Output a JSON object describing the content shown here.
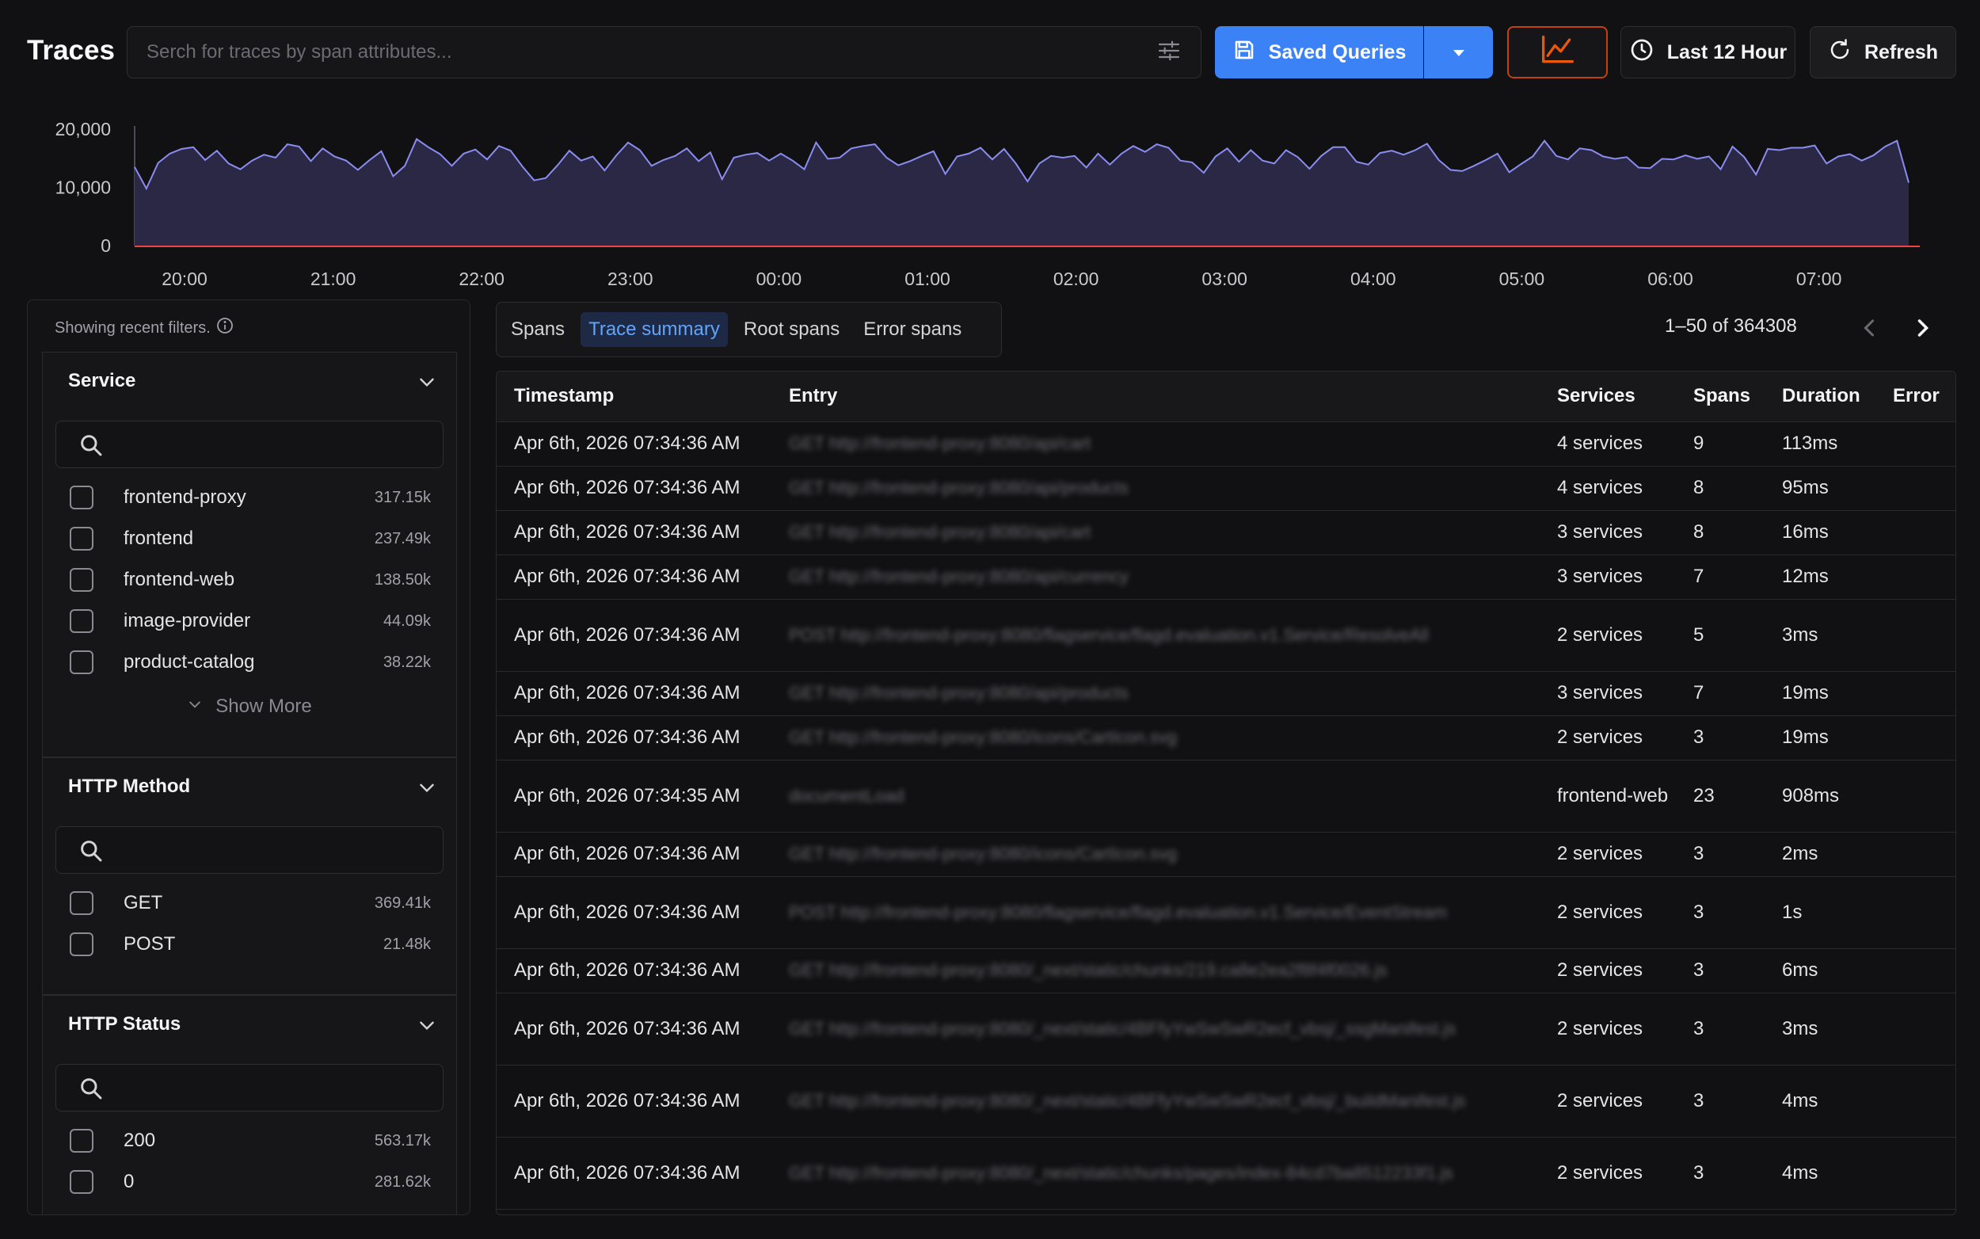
{
  "header": {
    "title": "Traces",
    "search_placeholder": "Serch for traces by span attributes...",
    "saved_queries_label": "Saved Queries",
    "time_range_label": "Last 12 Hour",
    "refresh_label": "Refresh"
  },
  "histogram": {
    "y_ticks": [
      "20,000",
      "10,000",
      "0"
    ],
    "x_ticks": [
      "20:00",
      "21:00",
      "22:00",
      "23:00",
      "00:00",
      "01:00",
      "02:00",
      "03:00",
      "04:00",
      "05:00",
      "06:00",
      "07:00"
    ],
    "ylim": [
      0,
      20000
    ],
    "series_color": "#8b8cf0",
    "error_color": "#ef4444",
    "values": [
      13500,
      9800,
      14200,
      15800,
      16600,
      16900,
      14700,
      16300,
      14100,
      13100,
      14600,
      15600,
      15100,
      17400,
      17000,
      14500,
      16700,
      15300,
      14600,
      13000,
      14700,
      16200,
      11900,
      13700,
      18300,
      16900,
      15700,
      13700,
      15800,
      16500,
      14800,
      17100,
      16300,
      13600,
      11200,
      11600,
      13800,
      16300,
      14600,
      15300,
      12900,
      15500,
      17700,
      16400,
      13700,
      14700,
      15400,
      16700,
      14500,
      16000,
      11400,
      15100,
      15600,
      15900,
      14600,
      15800,
      14600,
      13100,
      17700,
      14900,
      15100,
      16700,
      17100,
      17400,
      15100,
      13800,
      14500,
      15400,
      16200,
      12300,
      15300,
      15800,
      16800,
      14800,
      16600,
      14100,
      11000,
      14100,
      15400,
      15100,
      15400,
      13400,
      15800,
      13900,
      15800,
      17100,
      16100,
      17400,
      16800,
      14600,
      14300,
      12500,
      15300,
      16700,
      14400,
      16400,
      14600,
      14100,
      16400,
      15200,
      13200,
      15400,
      16900,
      16900,
      14400,
      13900,
      15900,
      16300,
      15600,
      16400,
      17500,
      14700,
      13000,
      12800,
      13700,
      14700,
      15800,
      12600,
      14000,
      15300,
      18000,
      15400,
      14800,
      16700,
      16400,
      15300,
      14900,
      15200,
      13400,
      13300,
      14900,
      14800,
      15500,
      14900,
      15300,
      13100,
      17000,
      15200,
      12200,
      16600,
      16400,
      16800,
      16800,
      17200,
      14100,
      15300,
      15700,
      14600,
      15500,
      17000,
      18000,
      10800
    ]
  },
  "filters": {
    "recent_note": "Showing recent filters.",
    "service": {
      "title": "Service",
      "options": [
        {
          "label": "frontend-proxy",
          "count": "317.15k"
        },
        {
          "label": "frontend",
          "count": "237.49k"
        },
        {
          "label": "frontend-web",
          "count": "138.50k"
        },
        {
          "label": "image-provider",
          "count": "44.09k"
        },
        {
          "label": "product-catalog",
          "count": "38.22k"
        }
      ],
      "show_more": "Show More"
    },
    "http_method": {
      "title": "HTTP Method",
      "options": [
        {
          "label": "GET",
          "count": "369.41k"
        },
        {
          "label": "POST",
          "count": "21.48k"
        }
      ]
    },
    "http_status": {
      "title": "HTTP Status",
      "options": [
        {
          "label": "200",
          "count": "563.17k"
        },
        {
          "label": "0",
          "count": "281.62k"
        }
      ]
    }
  },
  "tabs": [
    "Spans",
    "Trace summary",
    "Root spans",
    "Error spans"
  ],
  "active_tab": "Trace summary",
  "pagination": "1–50 of 364308",
  "table": {
    "headers": [
      "Timestamp",
      "Entry",
      "Services",
      "Spans",
      "Duration",
      "Error"
    ],
    "rows": [
      {
        "ts": "Apr 6th, 2026 07:34:36 AM",
        "entry": "GET http://frontend-proxy:8080/api/cart",
        "services": "4 services",
        "spans": "9",
        "duration": "113ms",
        "error": ""
      },
      {
        "ts": "Apr 6th, 2026 07:34:36 AM",
        "entry": "GET http://frontend-proxy:8080/api/products",
        "services": "4 services",
        "spans": "8",
        "duration": "95ms",
        "error": ""
      },
      {
        "ts": "Apr 6th, 2026 07:34:36 AM",
        "entry": "GET http://frontend-proxy:8080/api/cart",
        "services": "3 services",
        "spans": "8",
        "duration": "16ms",
        "error": ""
      },
      {
        "ts": "Apr 6th, 2026 07:34:36 AM",
        "entry": "GET http://frontend-proxy:8080/api/currency",
        "services": "3 services",
        "spans": "7",
        "duration": "12ms",
        "error": ""
      },
      {
        "ts": "Apr 6th, 2026 07:34:36 AM",
        "entry": "POST http://frontend-proxy:8080/flagservice/flagd.evaluation.v1.Service/ResolveAll",
        "services": "2 services",
        "spans": "5",
        "duration": "3ms",
        "error": ""
      },
      {
        "ts": "Apr 6th, 2026 07:34:36 AM",
        "entry": "GET http://frontend-proxy:8080/api/products",
        "services": "3 services",
        "spans": "7",
        "duration": "19ms",
        "error": ""
      },
      {
        "ts": "Apr 6th, 2026 07:34:36 AM",
        "entry": "GET http://frontend-proxy:8080/icons/CartIcon.svg",
        "services": "2 services",
        "spans": "3",
        "duration": "19ms",
        "error": ""
      },
      {
        "ts": "Apr 6th, 2026 07:34:35 AM",
        "entry": "documentLoad",
        "services": "frontend-web",
        "spans": "23",
        "duration": "908ms",
        "error": ""
      },
      {
        "ts": "Apr 6th, 2026 07:34:36 AM",
        "entry": "GET http://frontend-proxy:8080/icons/CartIcon.svg",
        "services": "2 services",
        "spans": "3",
        "duration": "2ms",
        "error": ""
      },
      {
        "ts": "Apr 6th, 2026 07:34:36 AM",
        "entry": "POST http://frontend-proxy:8080/flagservice/flagd.evaluation.v1.Service/EventStream",
        "services": "2 services",
        "spans": "3",
        "duration": "1s",
        "error": ""
      },
      {
        "ts": "Apr 6th, 2026 07:34:36 AM",
        "entry": "GET http://frontend-proxy:8080/_next/static/chunks/219.ca8e2ea2f8f4f0026.js",
        "services": "2 services",
        "spans": "3",
        "duration": "6ms",
        "error": ""
      },
      {
        "ts": "Apr 6th, 2026 07:34:36 AM",
        "entry": "GET http://frontend-proxy:8080/_next/static/4BFfyYwSwSwR2ecf_vbsj/_ssgManifest.js",
        "services": "2 services",
        "spans": "3",
        "duration": "3ms",
        "error": ""
      },
      {
        "ts": "Apr 6th, 2026 07:34:36 AM",
        "entry": "GET http://frontend-proxy:8080/_next/static/4BFfyYwSwSwR2ecf_vbsj/_buildManifest.js",
        "services": "2 services",
        "spans": "3",
        "duration": "4ms",
        "error": ""
      },
      {
        "ts": "Apr 6th, 2026 07:34:36 AM",
        "entry": "GET http://frontend-proxy:8080/_next/static/chunks/pages/index-84cd7ba8512233f1.js",
        "services": "2 services",
        "spans": "3",
        "duration": "4ms",
        "error": ""
      }
    ]
  }
}
